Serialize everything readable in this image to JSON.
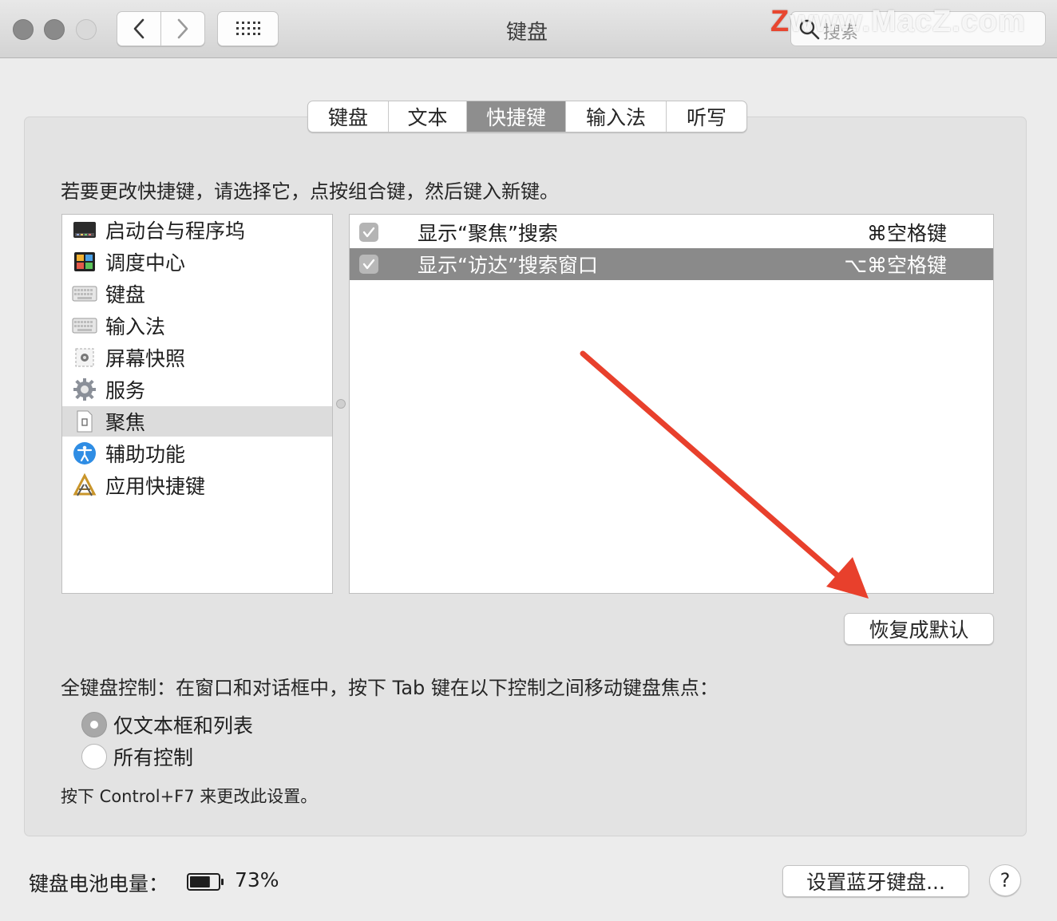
{
  "window": {
    "title": "键盘",
    "search_placeholder": "搜索",
    "watermark_z": "Z",
    "watermark_text": "www.MacZ.com"
  },
  "tabs": [
    {
      "label": "键盘",
      "selected": false
    },
    {
      "label": "文本",
      "selected": false
    },
    {
      "label": "快捷键",
      "selected": true
    },
    {
      "label": "输入法",
      "selected": false
    },
    {
      "label": "听写",
      "selected": false
    }
  ],
  "instruction": "若要更改快捷键，请选择它，点按组合键，然后键入新键。",
  "categories": [
    {
      "label": "启动台与程序坞",
      "icon": "launchpad-dock-icon"
    },
    {
      "label": "调度中心",
      "icon": "mission-control-icon"
    },
    {
      "label": "键盘",
      "icon": "keyboard-icon"
    },
    {
      "label": "输入法",
      "icon": "input-method-icon"
    },
    {
      "label": "屏幕快照",
      "icon": "screenshot-icon"
    },
    {
      "label": "服务",
      "icon": "gear-icon"
    },
    {
      "label": "聚焦",
      "icon": "spotlight-icon",
      "selected": true
    },
    {
      "label": "辅助功能",
      "icon": "accessibility-icon"
    },
    {
      "label": "应用快捷键",
      "icon": "app-shortcuts-icon"
    }
  ],
  "shortcuts": [
    {
      "checked": true,
      "name": "显示“聚焦”搜索",
      "key": "⌘空格键",
      "selected": false
    },
    {
      "checked": true,
      "name": "显示“访达”搜索窗口",
      "key": "⌥⌘空格键",
      "selected": true
    }
  ],
  "restore_button": "恢复成默认",
  "full_keyboard_access": {
    "label": "全键盘控制：在窗口和对话框中，按下 Tab 键在以下控制之间移动键盘焦点：",
    "options": [
      {
        "label": "仅文本框和列表",
        "selected": true
      },
      {
        "label": "所有控制",
        "selected": false
      }
    ],
    "hint": "按下 Control+F7 来更改此设置。"
  },
  "battery": {
    "label": "键盘电池电量：",
    "percent": "73%",
    "level": 0.73
  },
  "bluetooth_button": "设置蓝牙键盘...",
  "help_button": "?",
  "colors": {
    "arrow": "#e8402c",
    "selection": "#8a8a8a"
  }
}
